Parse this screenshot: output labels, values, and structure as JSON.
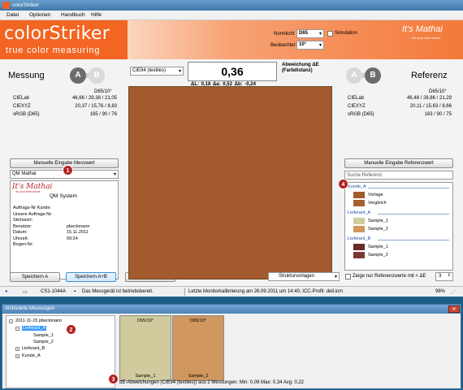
{
  "window": {
    "title": "colorStriker"
  },
  "menu": [
    "Datei",
    "Optionen",
    "Handbuch",
    "Hilfe"
  ],
  "banner": {
    "logo_main": "colorStriker",
    "logo_sub": "true color measuring",
    "normlicht_label": "Normlicht",
    "normlicht_value": "D65",
    "simulation_label": "Simulation",
    "beobachter_label": "Beobachter",
    "beobachter_value": "10°",
    "brand": "It's Mathai",
    "brand_tagline": "... it's your best choice"
  },
  "measurement": {
    "title": "Messung",
    "illuminant": "D65/10°",
    "rows": [
      {
        "k": "CIELab",
        "v": "46,66 / 29,38 / 21,05"
      },
      {
        "k": "CIEXYZ",
        "v": "20,37 / 15,76 / 8,83"
      },
      {
        "k": "sRGB  (D65)",
        "v": "165 / 90 / 76"
      }
    ],
    "manual_button": "Manuelle Eingabe Messwert",
    "source_select": "QM Mathai",
    "save_a": "Speichern A",
    "save_ab": "Speichern A+B",
    "archive": "Archiv"
  },
  "center": {
    "formula": "CIE94 (textiles)",
    "delta_e": "0,36",
    "delta_label": "Abweichung ΔE (Farbdistanz)",
    "sub_deltas": "ΔL: 0,18   Δa: 0,52   Δb: -0,24",
    "swatch_color": "#a25a2e",
    "structure_select": "Strukturvorlagen"
  },
  "reference": {
    "title": "Referenz",
    "illuminant": "D65/10°",
    "rows": [
      {
        "k": "CIELab",
        "v": "46,48 / 28,86 / 21,29"
      },
      {
        "k": "CIEXYZ",
        "v": "20,11 / 15,63 / 8,66"
      },
      {
        "k": "sRGB  (D65)",
        "v": "163 / 90 / 75"
      }
    ],
    "manual_button": "Manuelle Eingabe Referenzwert",
    "search_placeholder": "Suche Referenz:",
    "groups": [
      {
        "name": "Kunde_A",
        "items": [
          {
            "name": "Vorlage",
            "color": "#a25a2e"
          },
          {
            "name": "Vergleich",
            "color": "#a9602f"
          }
        ]
      },
      {
        "name": "Lieferant_A",
        "items": [
          {
            "name": "Sample_1",
            "color": "#d0cc9b"
          },
          {
            "name": "Sample_2",
            "color": "#d1975d"
          }
        ]
      },
      {
        "name": "Lieferant_B",
        "items": [
          {
            "name": "Sample_1",
            "color": "#6b2b26"
          },
          {
            "name": "Sample_2",
            "color": "#7a3a33"
          }
        ]
      }
    ],
    "show_only_label": "Zeige nur Referenzwerte mit < ΔE",
    "threshold": "3"
  },
  "qm": {
    "logo": "It's Mathai",
    "logo_sub": "it's your best choice",
    "title": "QM System",
    "fields": [
      {
        "k": "Auftrags-Nr Kunde:",
        "v": ""
      },
      {
        "k": "Unsere Auftrags-Nr:",
        "v": ""
      },
      {
        "k": "Stichwort:",
        "v": ""
      },
      {
        "k": "Benutzer:",
        "v": "pbeckmann"
      },
      {
        "k": "Datum:",
        "v": "15.11.2011"
      },
      {
        "k": "Uhrzeit:",
        "v": "09:24"
      },
      {
        "k": "Bogen-Nr:",
        "v": ""
      }
    ]
  },
  "status": {
    "device": "CS1-1044A",
    "ready": "Das Messgerät ist betriebsbereit.",
    "calibration": "Letzte Monitorkalibrierung am 26.09.2011 um 14:40, ICC-Profil: dell.icm",
    "zoom": "98%"
  },
  "archive": {
    "title": "Archivierte Messungen",
    "tree": {
      "root": "2011-11-15 pbeckmann",
      "child": "Lieferant_A",
      "leaf1": "Sample_1",
      "leaf2": "Sample_2",
      "sib1": "Lieferant_B",
      "sib2": "Kunde_A"
    },
    "swatches": [
      {
        "top": "D65/10°",
        "bottom": "Sample_1",
        "color": "#cfcb9c"
      },
      {
        "top": "D65/10°",
        "bottom": "Sample_2",
        "color": "#d0975f"
      }
    ],
    "footer": "dE-Abweichungen (CIE94 (textiles)) aus 2 Messungen:  Min: 0,09  Max: 0,34  Avg: 0,22"
  },
  "badges": [
    "1",
    "2",
    "3",
    "4"
  ]
}
